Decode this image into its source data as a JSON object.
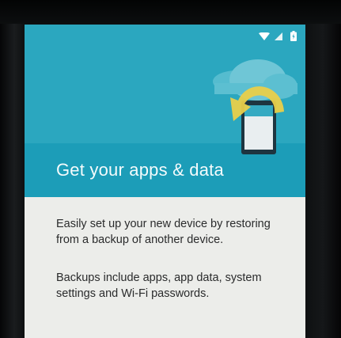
{
  "setup": {
    "title": "Get your apps & data",
    "paragraphs": [
      "Easily set up your new device by restoring from a backup of another device.",
      "Backups include apps, app data, system settings and Wi-Fi passwords."
    ]
  },
  "status_bar": {
    "icons": [
      "wifi-icon",
      "signal-icon",
      "battery-icon"
    ]
  },
  "illustration": {
    "icons": [
      "cloud-icon",
      "restore-arrow-icon",
      "phone-icon"
    ]
  },
  "colors": {
    "header": "#2ba7bf",
    "header_band": "#1c9db8",
    "body_background": "#ecedea",
    "arrow": "#e9cf4a"
  }
}
